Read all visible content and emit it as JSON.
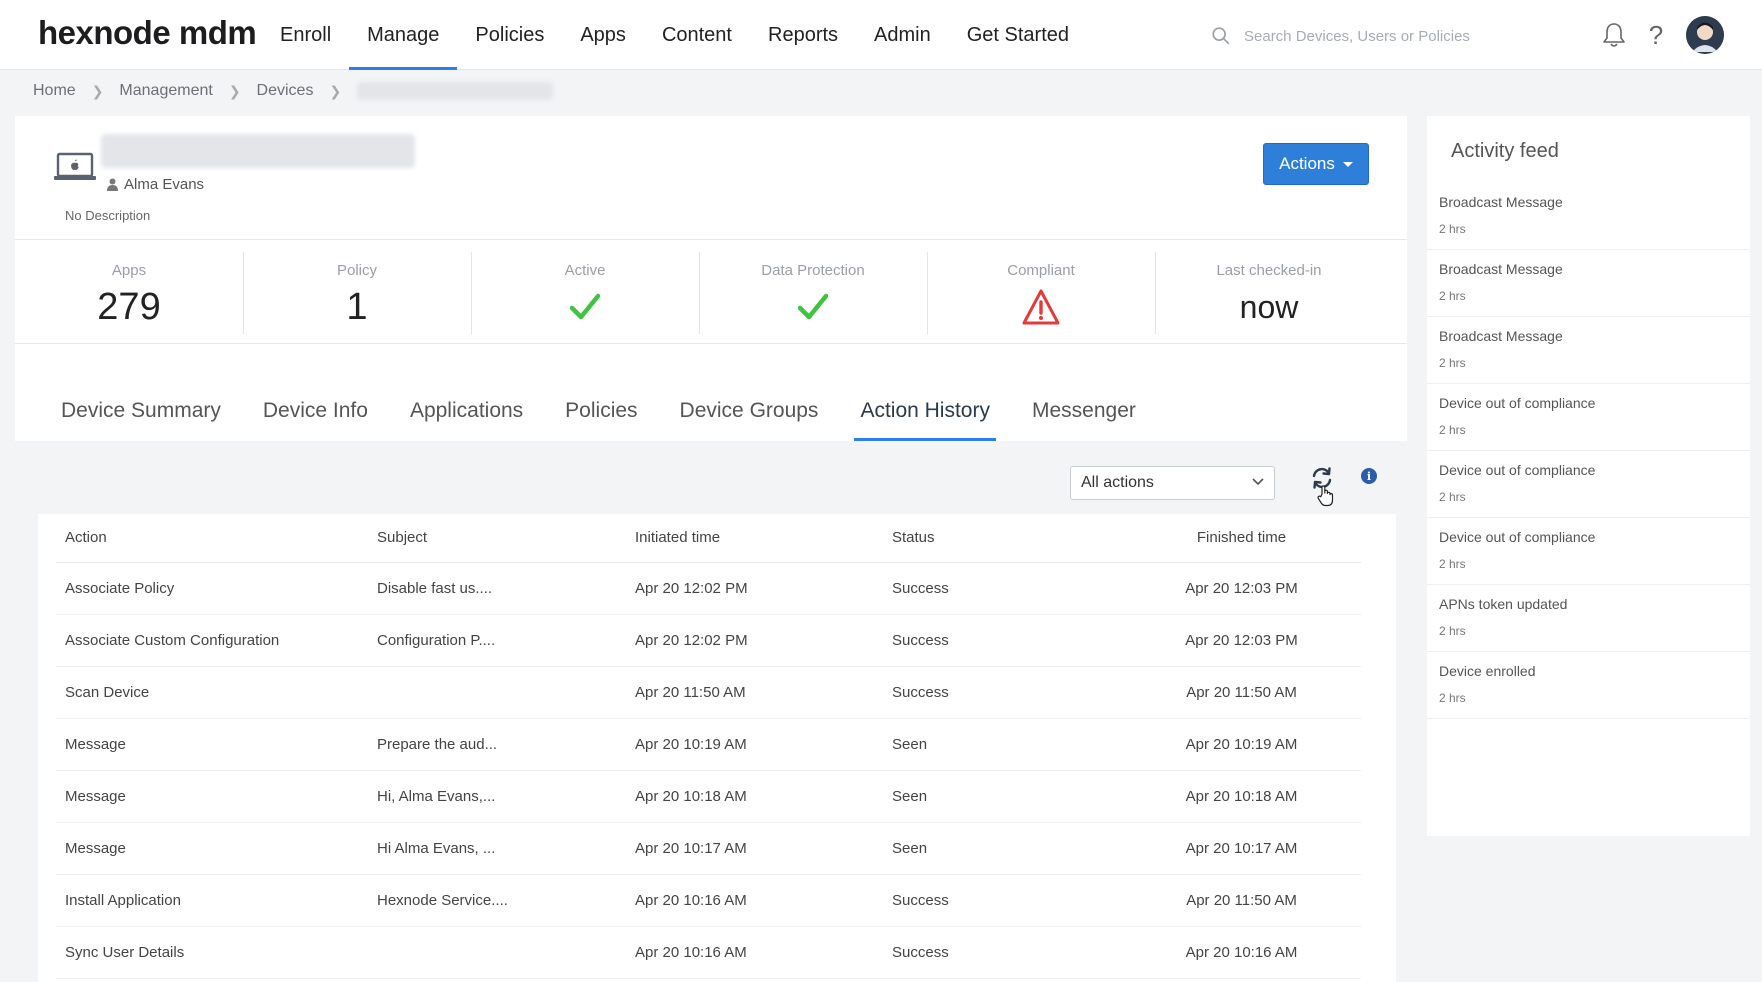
{
  "app": {
    "logo": "hexnode mdm"
  },
  "nav": {
    "items": [
      {
        "label": "Enroll"
      },
      {
        "label": "Manage"
      },
      {
        "label": "Policies"
      },
      {
        "label": "Apps"
      },
      {
        "label": "Content"
      },
      {
        "label": "Reports"
      },
      {
        "label": "Admin"
      },
      {
        "label": "Get Started"
      }
    ],
    "active": "Manage"
  },
  "search": {
    "placeholder": "Search Devices, Users or Policies"
  },
  "icons": {
    "search": "search-icon",
    "bell": "bell-icon",
    "help": "?",
    "avatar": "avatar-icon"
  },
  "breadcrumb": {
    "items": [
      "Home",
      "Management",
      "Devices"
    ]
  },
  "device": {
    "user": "Alma Evans",
    "description": "No Description",
    "actions_label": "Actions"
  },
  "stats": {
    "apps": {
      "label": "Apps",
      "value": "279"
    },
    "policy": {
      "label": "Policy",
      "value": "1"
    },
    "active": {
      "label": "Active"
    },
    "data_protection": {
      "label": "Data Protection"
    },
    "compliant": {
      "label": "Compliant"
    },
    "last_checked": {
      "label": "Last checked-in",
      "value": "now"
    }
  },
  "colors": {
    "accent": "#2b7de9",
    "check": "#3ec43e",
    "warning": "#e23b3b"
  },
  "tabs": [
    {
      "label": "Device Summary"
    },
    {
      "label": "Device Info"
    },
    {
      "label": "Applications"
    },
    {
      "label": "Policies"
    },
    {
      "label": "Device Groups"
    },
    {
      "label": "Action History"
    },
    {
      "label": "Messenger"
    }
  ],
  "filter": {
    "selected": "All actions"
  },
  "table": {
    "headers": [
      "Action",
      "Subject",
      "Initiated time",
      "Status",
      "Finished time"
    ],
    "rows": [
      [
        "Associate Policy",
        "Disable fast us....",
        "Apr 20 12:02 PM",
        "Success",
        "Apr 20 12:03 PM"
      ],
      [
        "Associate Custom Configuration",
        "Configuration P....",
        "Apr 20 12:02 PM",
        "Success",
        "Apr 20 12:03 PM"
      ],
      [
        "Scan Device",
        "",
        "Apr 20 11:50 AM",
        "Success",
        "Apr 20 11:50 AM"
      ],
      [
        "Message",
        "Prepare the aud...",
        "Apr 20 10:19 AM",
        "Seen",
        "Apr 20 10:19 AM"
      ],
      [
        "Message",
        "Hi, Alma Evans,...",
        "Apr 20 10:18 AM",
        "Seen",
        "Apr 20 10:18 AM"
      ],
      [
        "Message",
        "Hi Alma Evans, ...",
        "Apr 20 10:17 AM",
        "Seen",
        "Apr 20 10:17 AM"
      ],
      [
        "Install Application",
        "Hexnode Service....",
        "Apr 20 10:16 AM",
        "Success",
        "Apr 20 11:50 AM"
      ],
      [
        "Sync User Details",
        "",
        "Apr 20 10:16 AM",
        "Success",
        "Apr 20 10:16 AM"
      ]
    ]
  },
  "feed": {
    "title": "Activity feed",
    "items": [
      {
        "title": "Broadcast Message",
        "time": "2 hrs"
      },
      {
        "title": "Broadcast Message",
        "time": "2 hrs"
      },
      {
        "title": "Broadcast Message",
        "time": "2 hrs"
      },
      {
        "title": "Device out of compliance",
        "time": "2 hrs"
      },
      {
        "title": "Device out of compliance",
        "time": "2 hrs"
      },
      {
        "title": "Device out of compliance",
        "time": "2 hrs"
      },
      {
        "title": "APNs token updated",
        "time": "2 hrs"
      },
      {
        "title": "Device enrolled",
        "time": "2 hrs"
      }
    ]
  }
}
